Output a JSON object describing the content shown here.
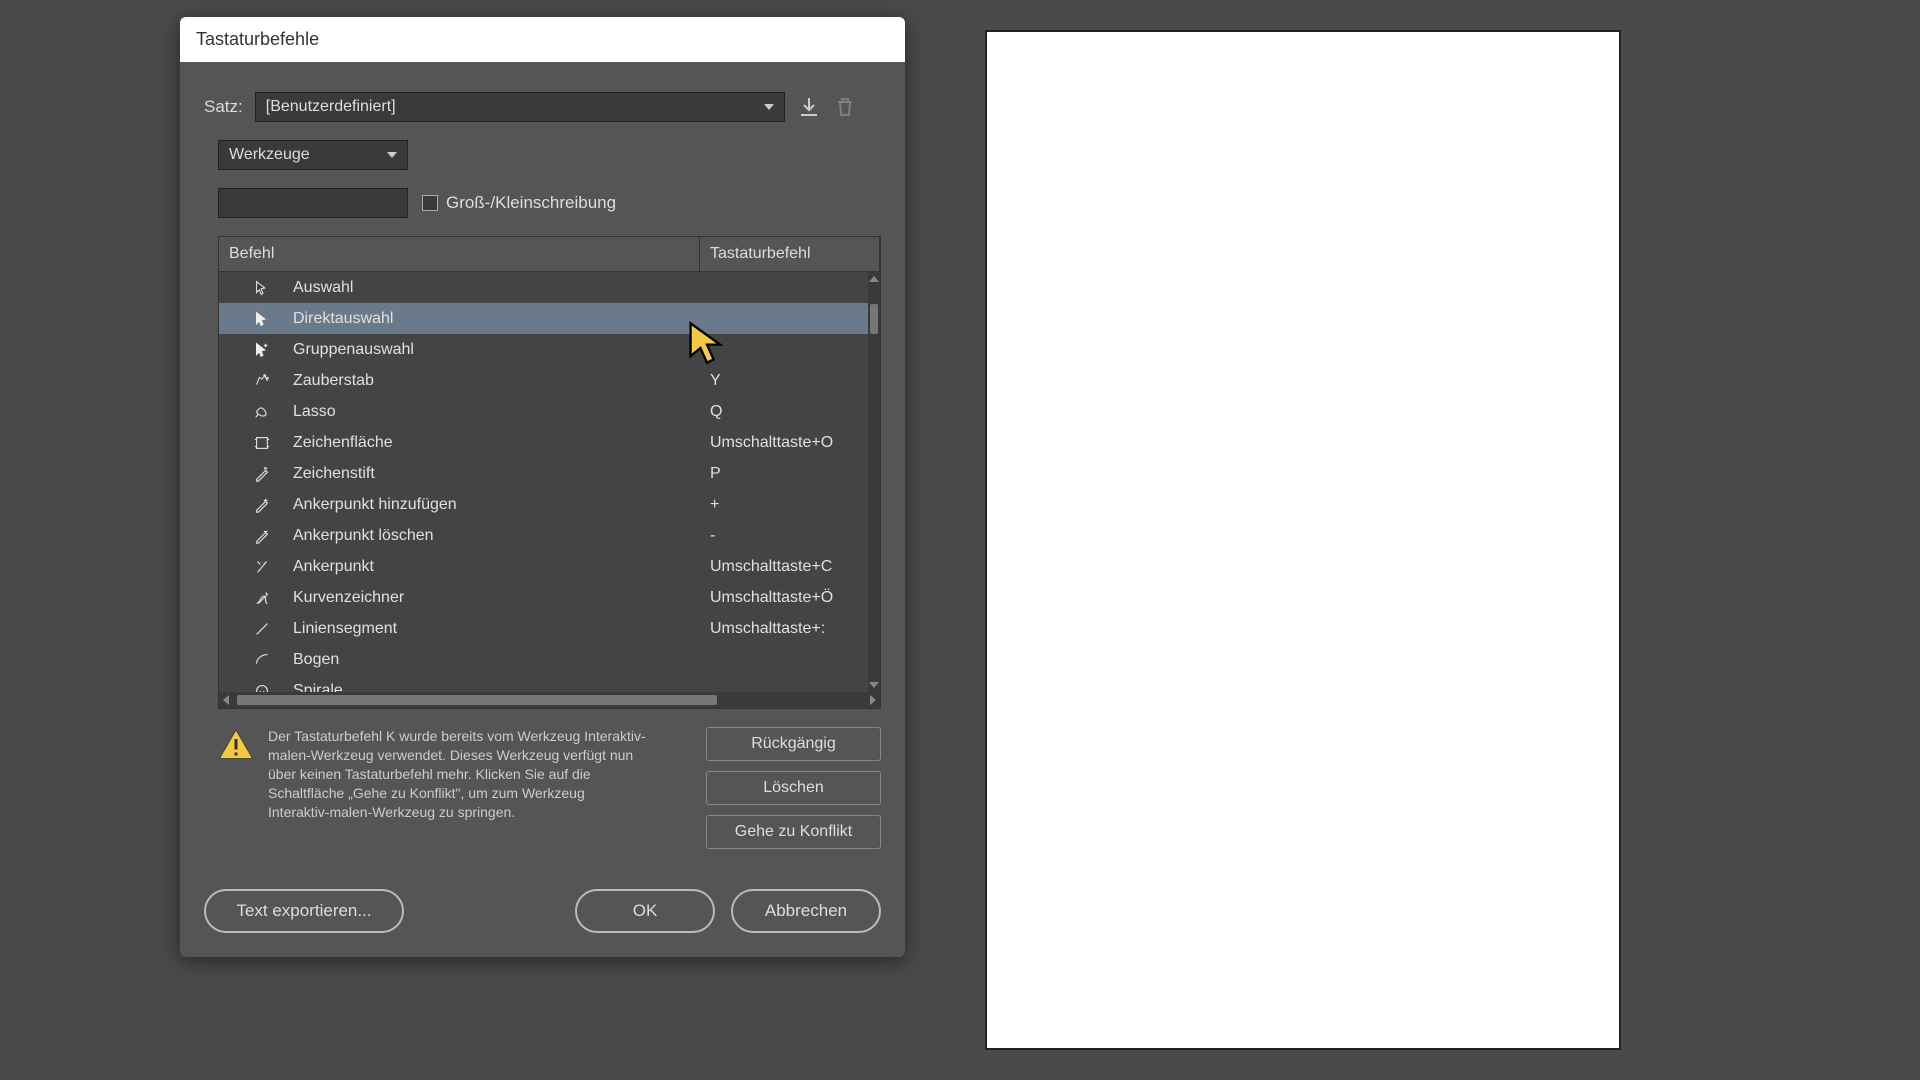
{
  "dialog": {
    "title": "Tastaturbefehle",
    "satz_label": "Satz:",
    "satz_value": "[Benutzerdefiniert]",
    "category_value": "Werkzeuge",
    "match_case_label": "Groß-/Kleinschreibung"
  },
  "table": {
    "col_command": "Befehl",
    "col_shortcut": "Tastaturbefehl",
    "rows": [
      {
        "label": "Auswahl",
        "shortcut": "",
        "selected": false
      },
      {
        "label": "Direktauswahl",
        "shortcut": "",
        "selected": true
      },
      {
        "label": "Gruppenauswahl",
        "shortcut": "",
        "selected": false
      },
      {
        "label": "Zauberstab",
        "shortcut": "Y",
        "selected": false
      },
      {
        "label": "Lasso",
        "shortcut": "Q",
        "selected": false
      },
      {
        "label": "Zeichenfläche",
        "shortcut": "Umschalttaste+O",
        "selected": false
      },
      {
        "label": "Zeichenstift",
        "shortcut": "P",
        "selected": false
      },
      {
        "label": "Ankerpunkt hinzufügen",
        "shortcut": "+",
        "selected": false
      },
      {
        "label": "Ankerpunkt löschen",
        "shortcut": "-",
        "selected": false
      },
      {
        "label": "Ankerpunkt",
        "shortcut": "Umschalttaste+C",
        "selected": false
      },
      {
        "label": "Kurvenzeichner",
        "shortcut": "Umschalttaste+Ö",
        "selected": false
      },
      {
        "label": "Liniensegment",
        "shortcut": "Umschalttaste+:",
        "selected": false
      },
      {
        "label": "Bogen",
        "shortcut": "",
        "selected": false
      },
      {
        "label": "Spirale",
        "shortcut": "",
        "selected": false
      }
    ]
  },
  "warning": {
    "text": "Der Tastaturbefehl K wurde bereits vom Werkzeug Interaktiv-malen-Werkzeug verwendet. Dieses Werkzeug verfügt nun über keinen Tastaturbefehl mehr. Klicken Sie auf die Schaltfläche „Gehe zu Konflikt\", um zum Werkzeug Interaktiv-malen-Werkzeug zu springen."
  },
  "buttons": {
    "undo": "Rückgängig",
    "delete": "Löschen",
    "goto_conflict": "Gehe zu Konflikt",
    "export": "Text exportieren...",
    "ok": "OK",
    "cancel": "Abbrechen"
  }
}
